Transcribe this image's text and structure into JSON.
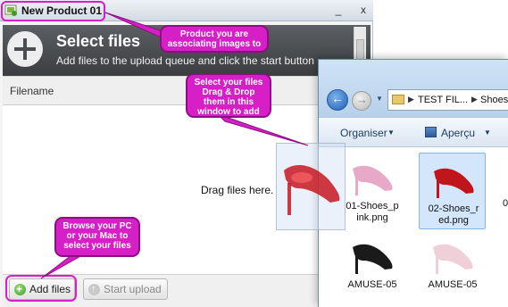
{
  "window": {
    "title": "New Product 01",
    "minimize": "_",
    "close": "x"
  },
  "uploader": {
    "heading": "Select files",
    "subheading": "Add files to the upload queue and click the start button",
    "column_filename": "Filename",
    "drop_hint": "Drag files here.",
    "add_files_label": "Add files",
    "start_upload_label": "Start upload"
  },
  "explorer": {
    "breadcrumb": [
      "TEST FIL...",
      "Shoes"
    ],
    "toolbar": {
      "organise_label": "Organiser",
      "preview_label": "Aperçu"
    },
    "files": [
      {
        "name": "01-Shoes_pink.png",
        "label": "01-Shoes_p\nink.png",
        "selected": false,
        "color": "#e8a8c8"
      },
      {
        "name": "02-Shoes_red.png",
        "label": "02-Shoes_r\ned.png",
        "selected": true,
        "color": "#c0151b"
      },
      {
        "name": "AMUSE-05",
        "label": "AMUSE-05",
        "selected": false,
        "color": "#1a1a1a"
      },
      {
        "name": "AMUSE-05",
        "label": "AMUSE-05",
        "selected": false,
        "color": "#f0d0d8"
      }
    ],
    "partial_label": "0"
  },
  "callouts": {
    "product": "Product you are associating images to",
    "drag_drop": "Select your files Drag & Drop them in this window to add",
    "browse": "Browse your PC or your Mac to select your files"
  },
  "colors": {
    "callout": "#d61fc7",
    "callout_border": "#8f0d84",
    "header_dark": "#3b3d40"
  }
}
